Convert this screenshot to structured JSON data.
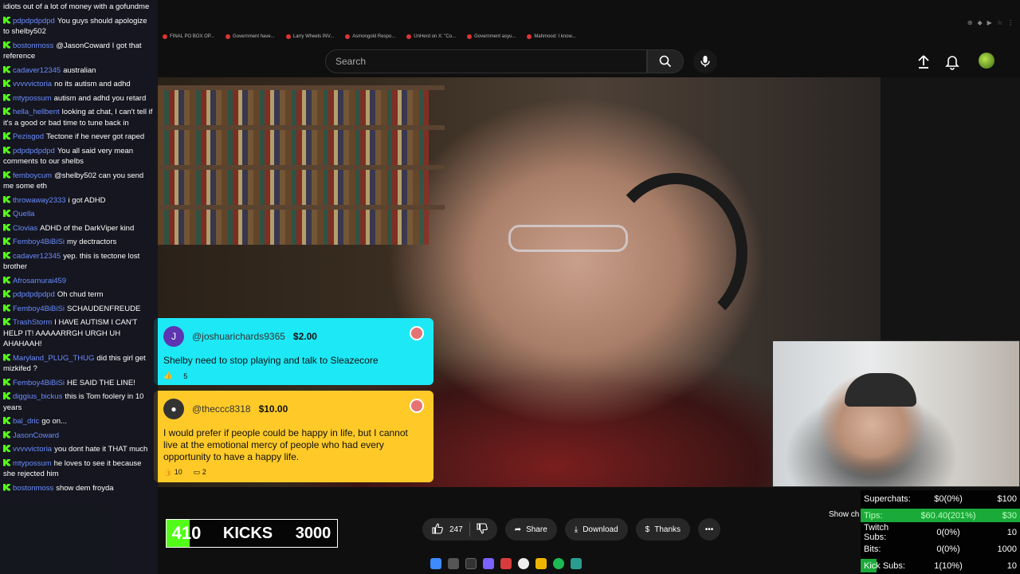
{
  "search": {
    "placeholder": "Search"
  },
  "bookmarks": [
    "FINAL PO BOX OP...",
    "Government have...",
    "Larry Wheels INV...",
    "Asmongold Respo...",
    "UnHerd on X: \"Co...",
    "Government asyu...",
    "Mahmood: I know..."
  ],
  "chat": [
    {
      "user": "",
      "text": "idiots out of a lot of money with a gofundme",
      "color": "b"
    },
    {
      "user": "pdpdpdpdpd",
      "text": "You guys should apologize to shelby502",
      "color": "b"
    },
    {
      "user": "bostonmoss",
      "text": "@JasonCoward I got that reference",
      "color": "b"
    },
    {
      "user": "cadaver12345",
      "text": "australian",
      "color": "b"
    },
    {
      "user": "vvvvvictoria",
      "text": "no its autism and adhd",
      "color": "b"
    },
    {
      "user": "mtypossum",
      "text": "autism and adhd you retard",
      "color": "b"
    },
    {
      "user": "hella_hellbent",
      "text": "looking at chat, I can't tell if it's a good or bad time to tune back in",
      "color": "b"
    },
    {
      "user": "Pezisgod",
      "text": "Tectone if he never got raped",
      "color": "b"
    },
    {
      "user": "pdpdpdpdpd",
      "text": "You all said very mean comments to our shelbs",
      "color": "b"
    },
    {
      "user": "femboycum",
      "text": "@shelby502 can you send me some eth",
      "color": "b"
    },
    {
      "user": "throwaway2333",
      "text": "i got ADHD",
      "color": "b"
    },
    {
      "user": "Quella",
      "text": "",
      "color": "g"
    },
    {
      "user": "Clovias",
      "text": "ADHD of the DarkViper kind",
      "color": "b"
    },
    {
      "user": "Femboy4BiBiSi",
      "text": "my dectractors",
      "color": "b"
    },
    {
      "user": "cadaver12345",
      "text": "yep. this is tectone lost brother",
      "color": "b"
    },
    {
      "user": "Afrosamurai459",
      "text": "",
      "color": "b"
    },
    {
      "user": "pdpdpdpdpd",
      "text": "Oh chud term",
      "color": "b"
    },
    {
      "user": "Femboy4BiBiSi",
      "text": "SCHAUDENFREUDE",
      "color": "b"
    },
    {
      "user": "TrashStorm",
      "text": "I HAVE AUTISM I CAN'T HELP IT! AAAAARRGH URGH UH AHAHAAH!",
      "color": "b"
    },
    {
      "user": "Maryland_PLUG_THUG",
      "text": "did this girl get mizkifed ?",
      "color": "b"
    },
    {
      "user": "Femboy4BiBiSi",
      "text": "HE SAID THE LINE!",
      "color": "b"
    },
    {
      "user": "diggius_bickus",
      "text": "this is Tom foolery in 10 years",
      "color": "b"
    },
    {
      "user": "bal_dric",
      "text": "go on...",
      "color": "b"
    },
    {
      "user": "JasonCoward",
      "text": "",
      "color": "b"
    },
    {
      "user": "vvvvvictoria",
      "text": "you dont hate it THAT much",
      "color": "b"
    },
    {
      "user": "mtypossum",
      "text": "he loves to see it because she rejected him",
      "color": "b"
    },
    {
      "user": "bostonmoss",
      "text": "show dem froyda",
      "color": "b"
    }
  ],
  "superchats": [
    {
      "initial": "J",
      "handle": "@joshuarichards9365",
      "amount": "$2.00",
      "message": "Shelby need to stop playing and talk to Sleazecore",
      "likes": "5",
      "replies": ""
    },
    {
      "initial": "",
      "handle": "@theccc8318",
      "amount": "$10.00",
      "message": "I would prefer if people could be happy in life, but I cannot live at the emotional mercy of people who had every opportunity to have a happy life.",
      "likes": "10",
      "replies": "2"
    }
  ],
  "actions": {
    "likes": "247",
    "share": "Share",
    "download": "Download",
    "thanks": "Thanks"
  },
  "show_chat": "Show ch",
  "kicks": {
    "current": "410",
    "label": "KICKS",
    "goal": "3000",
    "fraction": 0.137
  },
  "goals": [
    {
      "label": "Superchats:",
      "value": "$0(0%)",
      "target": "$100",
      "fraction": 0
    },
    {
      "label": "Tips:",
      "value": "$60.40(201%)",
      "target": "$30",
      "fraction": 1
    },
    {
      "label": "Twitch Subs:",
      "value": "0(0%)",
      "target": "10",
      "fraction": 0
    },
    {
      "label": "Bits:",
      "value": "0(0%)",
      "target": "1000",
      "fraction": 0
    },
    {
      "label": "Kick Subs:",
      "value": "1(10%)",
      "target": "10",
      "fraction": 0.1
    }
  ],
  "colors": {
    "kick_green": "#53fc18",
    "superchat_cyan": "#1de9f6",
    "superchat_yellow": "#ffca28"
  }
}
